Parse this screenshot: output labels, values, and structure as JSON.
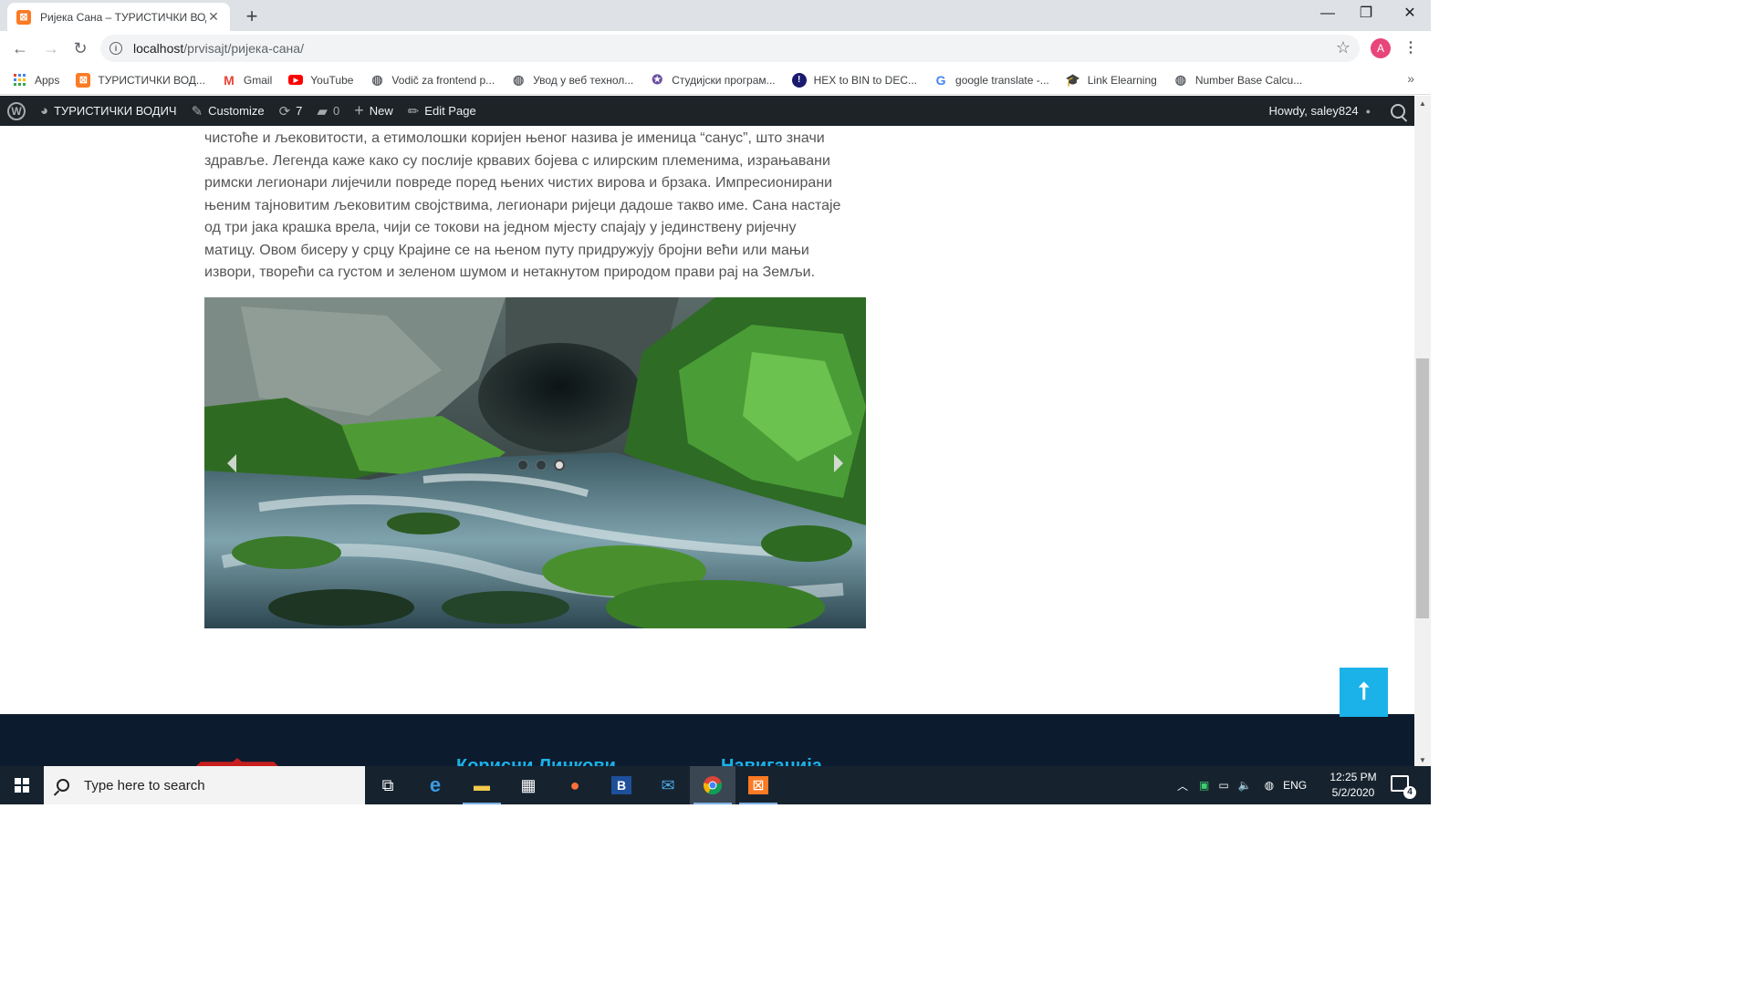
{
  "browser": {
    "tab_title": "Ријека Сана – ТУРИСТИЧКИ ВОДИЧ",
    "url_host": "localhost",
    "url_path": "/prvisajt/ријека-сана/",
    "profile_initial": "A"
  },
  "bookmarks": [
    {
      "label": "Apps",
      "icon": "apps-grid-icon"
    },
    {
      "label": "ТУРИСТИЧКИ ВОД...",
      "icon": "xampp-icon"
    },
    {
      "label": "Gmail",
      "icon": "gmail-icon"
    },
    {
      "label": "YouTube",
      "icon": "youtube-icon"
    },
    {
      "label": "Vodič za frontend p...",
      "icon": "globe-icon"
    },
    {
      "label": "Увод у веб технол...",
      "icon": "globe-icon"
    },
    {
      "label": "Студијски програм...",
      "icon": "university-seal-icon"
    },
    {
      "label": "HEX to BIN to DEC...",
      "icon": "hex-icon"
    },
    {
      "label": "google translate -...",
      "icon": "google-icon"
    },
    {
      "label": "Link Elearning",
      "icon": "graduation-cap-icon"
    },
    {
      "label": "Number Base Calcu...",
      "icon": "globe-icon"
    }
  ],
  "wpbar": {
    "site_name": "ТУРИСТИЧКИ ВОДИЧ",
    "customize": "Customize",
    "updates_count": "7",
    "comments_count": "0",
    "new_label": "New",
    "edit_label": "Edit Page",
    "howdy": "Howdy, saley824"
  },
  "article": {
    "lines": [
      "чистоће и љековитости, а етимолошки коријен њеног назива је именица “санус”, што значи",
      "здравље. Легенда каже како су послије крвавих бојева с илирским племенима, израњавани",
      "римски легионари лијечили повреде поред њених чистих вирова и брзака. Импресионирани",
      "њеним тајновитим љековитим својствима, легионари ријеци дадоше такво име. Сана настаје",
      "од три јака крашка врела, чији се токови на једном мјесту спајају у јединствену ријечну",
      "матицу. Овом бисеру у срцу Крајине се на њеном путу придружују бројни већи или мањи",
      "извори, творећи са густом и зеленом шумом и нетакнутом природом прави рај на Земљи."
    ]
  },
  "slider": {
    "slides": 3,
    "active_index": 2
  },
  "footer": {
    "heading_1": "Корисни Линкови",
    "heading_2": "Навигација"
  },
  "taskbar": {
    "search_placeholder": "Type here to search",
    "language": "ENG",
    "time": "12:25 PM",
    "date": "5/2/2020",
    "notifications": "4"
  },
  "colors": {
    "wp_admin_bar": "#1d2327",
    "accent_blue": "#1ab2e8",
    "footer_bg": "#0d1b2e",
    "taskbar_bg": "#16232f"
  }
}
